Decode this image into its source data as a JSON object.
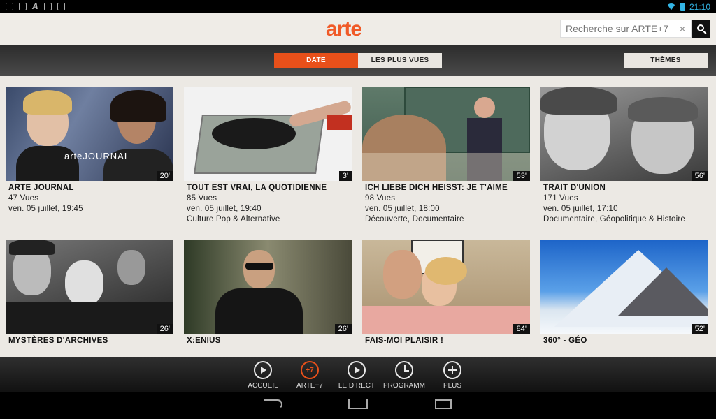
{
  "statusbar": {
    "time": "21:10"
  },
  "header": {
    "logo": "arte",
    "search_placeholder": "Recherche sur ARTE+7",
    "clear_symbol": "×"
  },
  "tabs": {
    "date": "DATE",
    "plus_vues": "LES PLUS VUES",
    "themes": "THÈMES"
  },
  "cards": [
    {
      "title": "ARTE JOURNAL",
      "views": "47 Vues",
      "date": "ven. 05 juillet, 19:45",
      "category": "",
      "duration": "20'"
    },
    {
      "title": "TOUT EST VRAI, LA QUOTIDIENNE",
      "views": "85 Vues",
      "date": "ven. 05 juillet, 19:40",
      "category": "Culture Pop & Alternative",
      "duration": "3'"
    },
    {
      "title": "ICH LIEBE DICH HEISST: JE T'AIME",
      "views": "98 Vues",
      "date": "ven. 05 juillet, 18:00",
      "category": "Découverte, Documentaire",
      "duration": "53'"
    },
    {
      "title": "TRAIT D'UNION",
      "views": "171 Vues",
      "date": "ven. 05 juillet, 17:10",
      "category": "Documentaire, Géopolitique & Histoire",
      "duration": "56'"
    },
    {
      "title": "MYSTÈRES D'ARCHIVES",
      "views": "",
      "date": "",
      "category": "",
      "duration": "26'"
    },
    {
      "title": "X:ENIUS",
      "views": "",
      "date": "",
      "category": "",
      "duration": "26'"
    },
    {
      "title": "FAIS-MOI PLAISIR !",
      "views": "",
      "date": "",
      "category": "",
      "duration": "84'"
    },
    {
      "title": "360° - GÉO",
      "views": "",
      "date": "",
      "category": "",
      "duration": "52'"
    }
  ],
  "thumb_text": {
    "journal_overlay": "arteJOURNAL"
  },
  "bottomnav": {
    "accueil": "ACCUEIL",
    "arte7": "ARTE+7",
    "arte7_icon": "+7",
    "direct": "LE DIRECT",
    "programme": "PROGRAMME",
    "plus": "PLUS"
  },
  "colors": {
    "accent": "#e8501a",
    "logo": "#f05a28"
  }
}
